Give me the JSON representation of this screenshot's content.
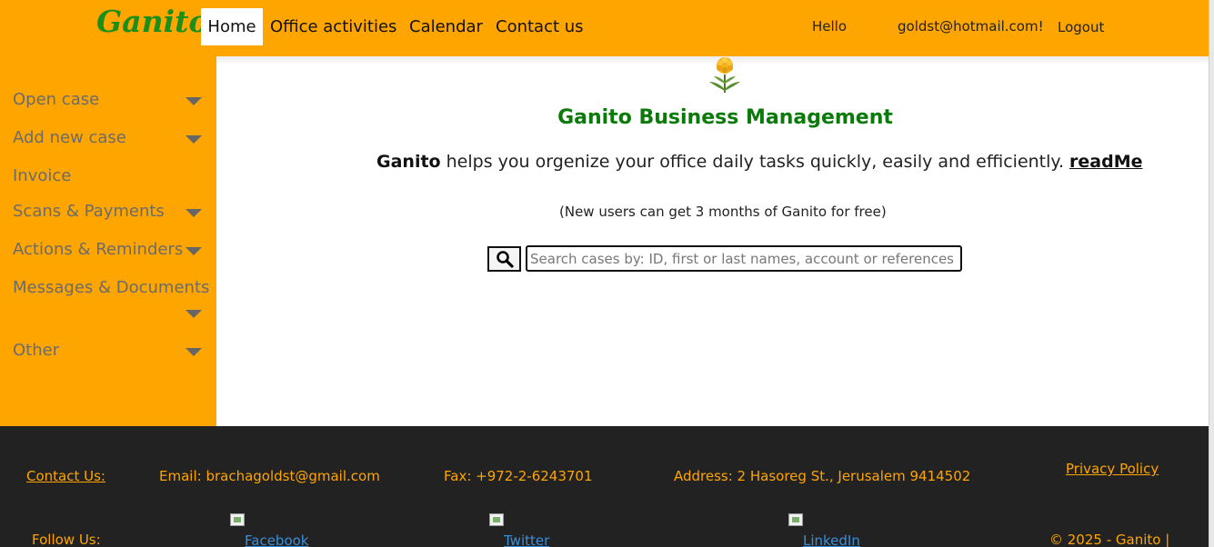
{
  "header": {
    "logo": "Ganito",
    "nav": {
      "home": "Home",
      "office": "Office activities",
      "calendar": "Calendar",
      "contact": "Contact us"
    },
    "greeting": "Hello",
    "user_email": "goldst@hotmail.com!",
    "logout": "Logout"
  },
  "sidebar": {
    "items": [
      {
        "label": "Open case",
        "has_dropdown": true
      },
      {
        "label": "Add new case",
        "has_dropdown": true
      },
      {
        "label": "Invoice",
        "has_dropdown": false
      },
      {
        "label": "Scans & Payments",
        "has_dropdown": true
      },
      {
        "label": "Actions & Reminders",
        "has_dropdown": true
      },
      {
        "label": "Messages & Documents",
        "has_dropdown": true
      },
      {
        "label": "Other",
        "has_dropdown": true
      }
    ]
  },
  "main": {
    "title": "Ganito Business Management",
    "tagline_brand": "Ganito",
    "tagline_text": " helps you orgenize your office daily tasks quickly, easily and efficiently. ",
    "readme": "readMe",
    "free_note": "(New users can get 3 months of Ganito for free)",
    "search": {
      "placeholder": "Search cases by: ID, first or last names, account or references",
      "value": ""
    }
  },
  "footer": {
    "contact_label": "Contact Us:",
    "email": "Email: brachagoldst@gmail.com",
    "fax": "Fax: +972-2-6243701",
    "address": "Address: 2 Hasoreg St., Jerusalem 9414502",
    "privacy": "Privacy Policy",
    "follow": "Follow Us:",
    "facebook": "Facebook",
    "twitter": "Twitter",
    "linkedin": "LinkedIn",
    "copyright": "© 2025 - Ganito |"
  },
  "colors": {
    "brand_orange": "#FFA500",
    "logo_green": "#1a8f1a",
    "title_green": "#0a7a0a",
    "footer_bg": "#222222",
    "link_blue": "#3b8fd9"
  },
  "icons": {
    "search": "magnifier-icon",
    "dropdown": "caret-down-icon",
    "logo_image": "dandelion-icon"
  }
}
